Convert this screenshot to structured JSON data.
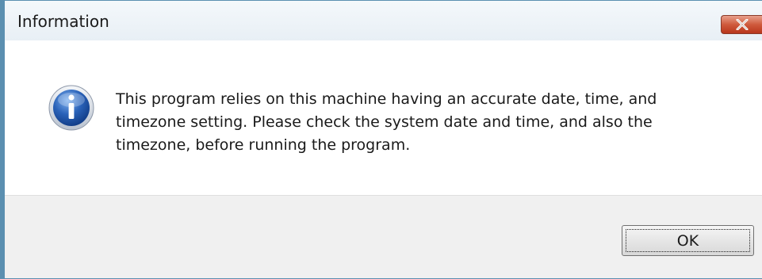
{
  "dialog": {
    "title": "Information",
    "icon": "info-icon",
    "message": "This program relies on this machine having an accurate date, time, and\ntimezone setting.  Please check the system date and time, and also the\ntimezone, before running the program.",
    "ok_label": "OK",
    "close_icon": "close-icon"
  },
  "colors": {
    "close_button": "#c7472b",
    "info_icon": "#2a62b8",
    "footer_bg": "#f0f0f0",
    "frame": "#5b8fb0"
  }
}
